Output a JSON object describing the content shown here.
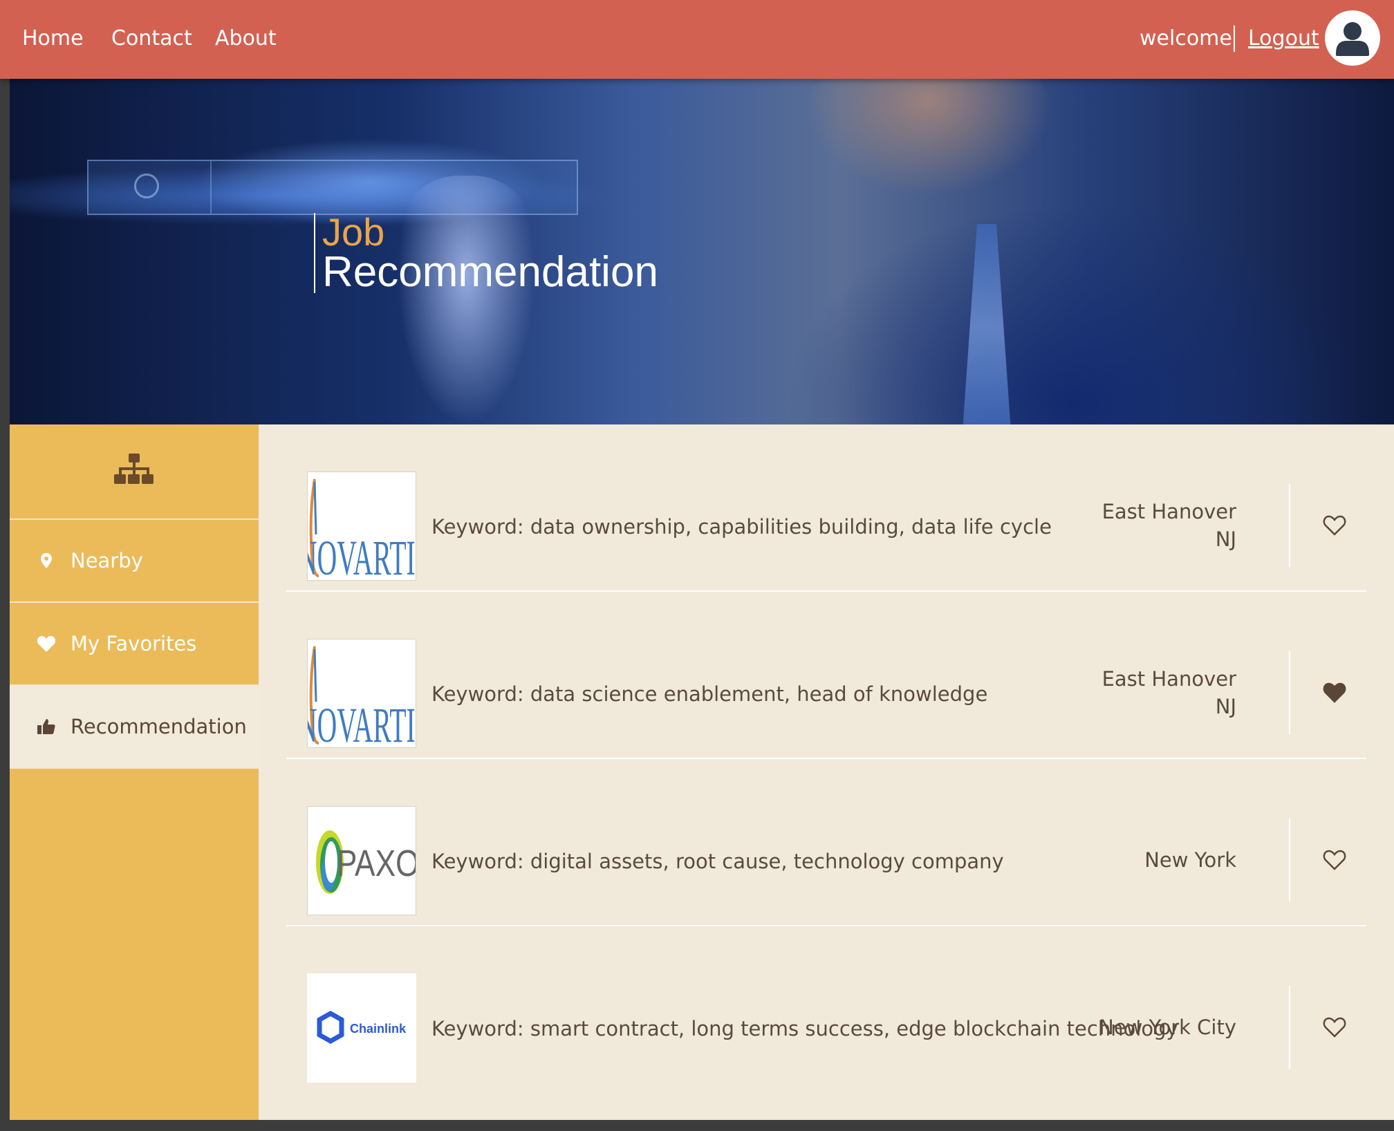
{
  "nav": {
    "links": [
      "Home",
      "Contact",
      "About"
    ],
    "welcome": "welcome",
    "logout": "Logout"
  },
  "hero": {
    "title_line1": "Job",
    "title_line2": "Recommendation",
    "colors": {
      "accent": "#e9a54a",
      "title": "#ffffff"
    }
  },
  "sidebar": {
    "header_icon": "sitemap-icon",
    "items": [
      {
        "label": "Nearby",
        "icon": "map-marker-icon",
        "active": false
      },
      {
        "label": "My Favorites",
        "icon": "heart-icon",
        "active": false
      },
      {
        "label": "Recommendation",
        "icon": "thumbs-up-icon",
        "active": true
      }
    ]
  },
  "jobs": [
    {
      "company_logo": "NOVARTIS",
      "keywords": "Keyword: data ownership, capabilities building, data life cycle",
      "location_line1": "East Hanover",
      "location_line2": "NJ",
      "favorited": false
    },
    {
      "company_logo": "NOVARTIS",
      "keywords": "Keyword: data science enablement, head of knowledge",
      "location_line1": "East Hanover",
      "location_line2": "NJ",
      "favorited": true
    },
    {
      "company_logo": "PAXOS",
      "keywords": "Keyword: digital assets, root cause, technology company",
      "location_line1": "New York",
      "location_line2": "",
      "favorited": false
    },
    {
      "company_logo": "Chainlink",
      "keywords": "Keyword: smart contract, long terms success, edge blockchain technology",
      "location_line1": "New York City",
      "location_line2": "",
      "favorited": false
    }
  ],
  "colors": {
    "topbar": "#d36152",
    "sidebar": "#ebbb5a",
    "content_bg": "#f1eadb",
    "text": "#5a4a3e"
  }
}
